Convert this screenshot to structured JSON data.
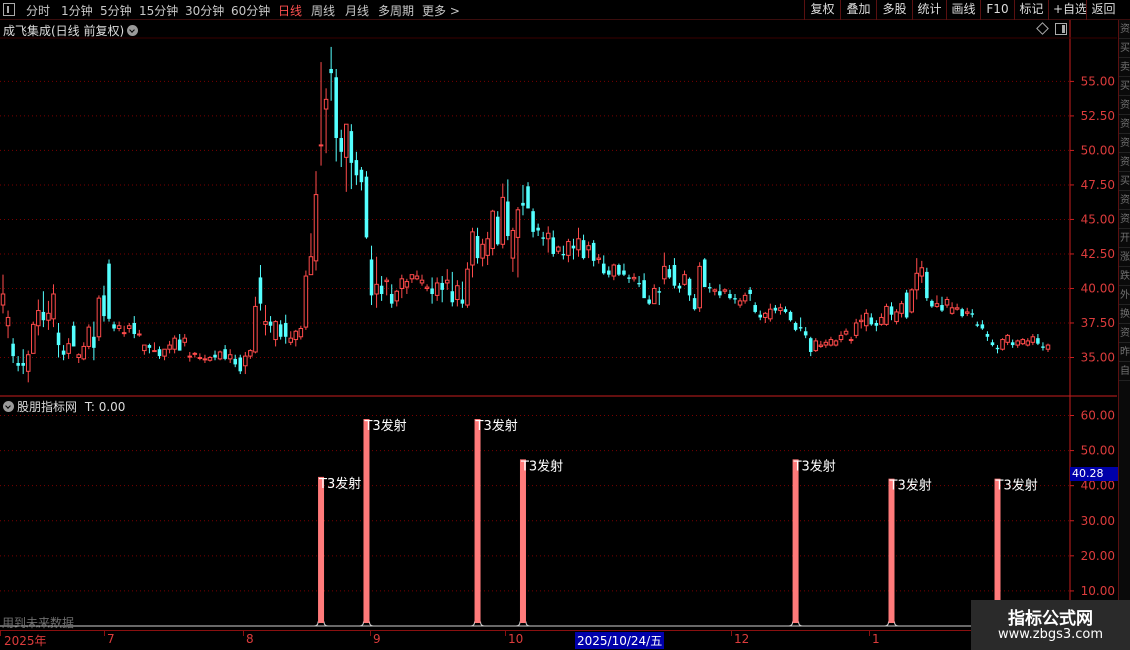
{
  "toolbar": {
    "periods": [
      "分时",
      "1分钟",
      "5分钟",
      "15分钟",
      "30分钟",
      "60分钟",
      "日线",
      "周线",
      "月线",
      "多周期",
      "更多 >"
    ],
    "active_period": "日线",
    "right_buttons": [
      "复权",
      "叠加",
      "多股",
      "统计",
      "画线",
      "F10",
      "标记",
      "+自选",
      "返回"
    ]
  },
  "main_chart": {
    "title": "成飞集成(日线 前复权)",
    "y_ticks": [
      "55.00",
      "52.50",
      "50.00",
      "47.50",
      "45.00",
      "42.50",
      "40.00",
      "37.50",
      "35.00"
    ]
  },
  "sub_chart": {
    "title": "股朋指标网",
    "t_label": "T: 0.00",
    "y_ticks": [
      "60.00",
      "50.00",
      "40.00",
      "30.00",
      "20.00",
      "10.00"
    ],
    "current_value": "40.28",
    "future_note": "用到未来数据",
    "signal_label": "T3发射"
  },
  "date_axis": {
    "labels": [
      "2025年",
      "7",
      "8",
      "9",
      "10",
      "12",
      "1"
    ],
    "cursor_date": "2025/10/24/五"
  },
  "right_strip": [
    "资",
    "买",
    "卖",
    "买",
    "资",
    "资",
    "资",
    "资",
    "买",
    "资",
    "资",
    "开",
    "涨",
    "跌",
    "外",
    "换",
    "资",
    "昨",
    "自"
  ],
  "watermark": {
    "title": "指标公式网",
    "url": "www.zbgs3.com"
  },
  "colors": {
    "up": "#ff4b4b",
    "down": "#54ffff",
    "signal": "#ff7a7a",
    "grid": "#7a0000",
    "axis": "#c81e1e"
  },
  "chart_data": [
    {
      "type": "candlestick",
      "title": "成飞集成(日线 前复权)",
      "ylim": [
        32.5,
        58
      ],
      "y_ticks": [
        55,
        52.5,
        50,
        47.5,
        45,
        42.5,
        40,
        37.5,
        35
      ],
      "ohlc": [
        [
          38.8,
          41,
          38.2,
          39.6
        ],
        [
          37.3,
          38.4,
          36.4,
          37.9
        ],
        [
          36,
          36.4,
          34.6,
          35.1
        ],
        [
          34.6,
          35.1,
          34,
          34.4
        ],
        [
          34.6,
          35.6,
          33.8,
          34.4
        ],
        [
          34,
          35.5,
          33.2,
          35.2
        ],
        [
          35.3,
          37.6,
          35.3,
          37.4
        ],
        [
          37.3,
          39.2,
          36.6,
          38.4
        ],
        [
          38.3,
          39.8,
          37.2,
          37.7
        ],
        [
          37.7,
          39.1,
          37,
          38.2
        ],
        [
          37.8,
          40.3,
          37.2,
          39.6
        ],
        [
          36.8,
          37.5,
          35,
          35.9
        ],
        [
          35.5,
          35.9,
          34.8,
          35.2
        ],
        [
          35.3,
          36.4,
          34.9,
          36
        ],
        [
          37.3,
          37.6,
          35.8,
          35.8
        ],
        [
          35,
          35.3,
          34.6,
          35.2
        ],
        [
          34.9,
          36.1,
          34.8,
          35.8
        ],
        [
          35.8,
          37.4,
          35.6,
          37.2
        ],
        [
          36.5,
          37.6,
          34.8,
          35.7
        ],
        [
          36.5,
          39.5,
          36.2,
          39.3
        ],
        [
          39.5,
          40.2,
          37.6,
          38
        ],
        [
          41.8,
          42.1,
          37.6,
          37.8
        ],
        [
          37.4,
          37.6,
          36.9,
          37.1
        ],
        [
          37.1,
          37.6,
          36.9,
          37.3
        ],
        [
          36.8,
          37.3,
          36.5,
          36.8
        ],
        [
          37.1,
          37.5,
          36.8,
          37.3
        ],
        [
          37.5,
          38,
          36.4,
          36.7
        ],
        [
          36.7,
          37,
          36.5,
          36.7
        ],
        [
          35.5,
          35.9,
          35.2,
          35.9
        ],
        [
          35.9,
          36,
          35.3,
          35.7
        ],
        [
          35.5,
          36.1,
          35.4,
          35.5
        ],
        [
          35.6,
          35.8,
          34.9,
          35.1
        ],
        [
          35.1,
          35.6,
          34.8,
          35.6
        ],
        [
          35.6,
          36.2,
          35.3,
          35.9
        ],
        [
          35.6,
          36.6,
          35.3,
          36.4
        ],
        [
          36.3,
          36.7,
          35.5,
          35.5
        ],
        [
          36.1,
          36.7,
          35.8,
          36.4
        ],
        [
          35.1,
          35.4,
          34.7,
          35.1
        ],
        [
          35.3,
          35.4,
          35,
          35.3
        ],
        [
          35,
          35.3,
          34.8,
          35
        ],
        [
          34.9,
          35.2,
          34.6,
          34.9
        ],
        [
          34.8,
          35.1,
          34.7,
          35
        ],
        [
          35.2,
          35.5,
          34.8,
          35
        ],
        [
          34.9,
          35.5,
          34.8,
          35.4
        ],
        [
          35.6,
          35.9,
          34.8,
          34.9
        ],
        [
          34.9,
          35.6,
          34.6,
          35.2
        ],
        [
          34.9,
          35.2,
          34.3,
          34.5
        ],
        [
          35,
          35.2,
          33.8,
          34
        ],
        [
          34.4,
          35.4,
          33.8,
          35.1
        ],
        [
          35.1,
          35.6,
          34.9,
          35.5
        ],
        [
          35.4,
          39.4,
          35.3,
          38.7
        ],
        [
          40.8,
          41.7,
          38.4,
          38.9
        ],
        [
          37.4,
          38.8,
          36.6,
          37.6
        ],
        [
          37.6,
          38,
          36.8,
          37.3
        ],
        [
          36.3,
          37.7,
          35.8,
          37.6
        ],
        [
          37.4,
          37.7,
          36.3,
          36.5
        ],
        [
          37.5,
          38.1,
          36,
          36.5
        ],
        [
          36.1,
          36.9,
          35.9,
          36.4
        ],
        [
          36.3,
          37,
          35.8,
          36.9
        ],
        [
          36.5,
          37.3,
          36.3,
          37.1
        ],
        [
          37.2,
          41.3,
          37,
          40.9
        ],
        [
          41,
          44,
          41,
          42.3
        ],
        [
          42,
          48.5,
          41.3,
          46.8
        ],
        [
          50.4,
          56.4,
          48.9,
          50.4
        ],
        [
          53,
          54.5,
          49.8,
          53.7
        ],
        [
          55.9,
          57.5,
          53.6,
          55.6
        ],
        [
          55.3,
          55.9,
          49.2,
          50.9
        ],
        [
          50.9,
          51.5,
          48.8,
          49.9
        ],
        [
          49.5,
          51.9,
          47,
          51.9
        ],
        [
          51.4,
          51.9,
          47.2,
          49.1
        ],
        [
          49.3,
          49.9,
          47.5,
          48.2
        ],
        [
          48.6,
          48.8,
          47.1,
          47.7
        ],
        [
          48.1,
          48.5,
          43.6,
          43.7
        ],
        [
          42.1,
          43.1,
          38.8,
          39.5
        ],
        [
          39.6,
          42.3,
          38.6,
          40.3
        ],
        [
          40.2,
          40.9,
          39.1,
          39.6
        ],
        [
          40.5,
          40.8,
          39.5,
          40.6
        ],
        [
          39.6,
          40.3,
          38.6,
          38.9
        ],
        [
          39.1,
          39.9,
          38.7,
          39.8
        ],
        [
          40,
          41,
          39.3,
          40.7
        ],
        [
          40.1,
          40.7,
          39.6,
          40.5
        ],
        [
          40.7,
          41,
          40.4,
          41
        ],
        [
          40.7,
          41.3,
          40.6,
          40.9
        ],
        [
          40.4,
          41,
          40.2,
          40.6
        ],
        [
          40,
          40.3,
          39.8,
          40.1
        ],
        [
          40,
          40.8,
          38.9,
          39.6
        ],
        [
          39.5,
          40.8,
          39.1,
          40.4
        ],
        [
          40.4,
          40.9,
          39,
          39.9
        ],
        [
          40.4,
          41.4,
          39.9,
          40.6
        ],
        [
          39.8,
          41.2,
          38.7,
          39
        ],
        [
          39.2,
          40.6,
          38.7,
          40.2
        ],
        [
          39.2,
          40.5,
          38.6,
          38.9
        ],
        [
          38.8,
          41.9,
          38.6,
          41.4
        ],
        [
          41.7,
          44.4,
          40.8,
          44.1
        ],
        [
          43.8,
          44.4,
          41.8,
          42.2
        ],
        [
          42.2,
          43.6,
          41.6,
          43.2
        ],
        [
          42.4,
          44.1,
          41.7,
          43.6
        ],
        [
          42.9,
          45.7,
          42.4,
          45.6
        ],
        [
          45.2,
          45.6,
          43.1,
          43.2
        ],
        [
          43.2,
          47.6,
          42.9,
          46.6
        ],
        [
          46.3,
          47.9,
          43.5,
          43.8
        ],
        [
          42.2,
          44.4,
          41.2,
          44.2
        ],
        [
          43.7,
          45.9,
          40.8,
          45.7
        ],
        [
          46.2,
          47.5,
          45.3,
          46
        ],
        [
          47.4,
          47.7,
          45.8,
          45.8
        ],
        [
          45.6,
          45.8,
          43.7,
          44.1
        ],
        [
          44.4,
          44.7,
          43.8,
          44.2
        ],
        [
          43.7,
          44.1,
          43.1,
          43.6
        ],
        [
          43.6,
          44.5,
          42.6,
          44
        ],
        [
          43.7,
          44.2,
          42.3,
          42.5
        ],
        [
          42.7,
          43.1,
          42.5,
          43
        ],
        [
          42.5,
          43.1,
          42.1,
          42.4
        ],
        [
          42.4,
          43.6,
          41.9,
          43.4
        ],
        [
          43.1,
          43.6,
          42.1,
          42.9
        ],
        [
          42.8,
          44.4,
          42.3,
          43.6
        ],
        [
          43.5,
          43.9,
          42.1,
          42.2
        ],
        [
          42.8,
          43.4,
          42.2,
          43.1
        ],
        [
          43.3,
          43.5,
          41.6,
          42
        ],
        [
          42.1,
          42.5,
          41.8,
          42.2
        ],
        [
          41.8,
          42.4,
          41,
          41.1
        ],
        [
          41.3,
          41.6,
          40.8,
          41
        ],
        [
          40.9,
          41.8,
          40.6,
          41.7
        ],
        [
          41.7,
          41.8,
          40.9,
          41
        ],
        [
          41.3,
          41.8,
          40.9,
          41
        ],
        [
          40.8,
          41,
          40.4,
          40.7
        ],
        [
          40.7,
          41.1,
          40.5,
          40.8
        ],
        [
          40.4,
          40.9,
          40.1,
          40.3
        ],
        [
          40.6,
          41.1,
          39.4,
          39.3
        ],
        [
          39.2,
          39.5,
          38.8,
          38.9
        ],
        [
          38.9,
          40.3,
          38.9,
          40
        ],
        [
          39.8,
          40.1,
          38.8,
          39.7
        ],
        [
          40.7,
          42.6,
          40.3,
          41.6
        ],
        [
          41.4,
          41.7,
          40.7,
          40.8
        ],
        [
          41.7,
          42.2,
          40,
          40.2
        ],
        [
          40.2,
          40.4,
          39.7,
          40
        ],
        [
          40.3,
          41.3,
          40.2,
          41
        ],
        [
          40.7,
          40.8,
          39.1,
          39.5
        ],
        [
          39.3,
          39.6,
          38.4,
          38.5
        ],
        [
          38.6,
          41.9,
          38.3,
          41.6
        ],
        [
          42.1,
          42.2,
          40.1,
          40.1
        ],
        [
          40.1,
          40.4,
          39.7,
          40
        ],
        [
          39.8,
          40,
          39.5,
          39.9
        ],
        [
          39.8,
          40.3,
          39.3,
          39.5
        ],
        [
          39.8,
          40,
          39.6,
          39.9
        ],
        [
          39.6,
          39.9,
          39.2,
          39.3
        ],
        [
          39.3,
          39.6,
          38.9,
          39.2
        ],
        [
          38.8,
          39.3,
          38.6,
          39.1
        ],
        [
          39.1,
          39.7,
          38.9,
          39.5
        ],
        [
          39.9,
          40.1,
          39.1,
          39.6
        ],
        [
          38.8,
          39,
          38.2,
          38.3
        ],
        [
          38.1,
          38.4,
          37.7,
          37.9
        ],
        [
          37.9,
          38.3,
          37.5,
          38.2
        ],
        [
          37.8,
          38.9,
          37.6,
          38.5
        ],
        [
          38.6,
          38.8,
          38.2,
          38.4
        ],
        [
          38.4,
          38.9,
          38.1,
          38.6
        ],
        [
          38.5,
          38.7,
          38.2,
          38.3
        ],
        [
          38.3,
          38.4,
          37.6,
          37.7
        ],
        [
          37.5,
          37.6,
          36.9,
          37
        ],
        [
          37.2,
          37.9,
          36.9,
          37.1
        ],
        [
          36.9,
          37.2,
          36.4,
          36.6
        ],
        [
          36.4,
          36.5,
          35.1,
          35.4
        ],
        [
          35.5,
          36.4,
          35.4,
          36.2
        ],
        [
          35.8,
          36.2,
          35.7,
          35.9
        ],
        [
          35.9,
          36.3,
          35.7,
          36.1
        ],
        [
          35.9,
          36.5,
          35.8,
          36.3
        ],
        [
          35.9,
          36.3,
          35.8,
          36.2
        ],
        [
          36.3,
          36.9,
          36.1,
          36.6
        ],
        [
          36.7,
          37.1,
          36.6,
          36.9
        ],
        [
          36.3,
          36.5,
          36,
          36.3
        ],
        [
          36.6,
          37.8,
          36.4,
          37.5
        ],
        [
          37.6,
          38.1,
          37.1,
          37.7
        ],
        [
          37.3,
          38.5,
          36.9,
          38.2
        ],
        [
          37.9,
          38.2,
          37.3,
          37.4
        ],
        [
          37.5,
          37.7,
          36.9,
          37.3
        ],
        [
          37.4,
          38.2,
          37.3,
          37.9
        ],
        [
          37.4,
          38.9,
          37.3,
          38.7
        ],
        [
          38.7,
          39,
          37.7,
          38.1
        ],
        [
          37.6,
          38.5,
          37.4,
          38.3
        ],
        [
          38.2,
          39.1,
          37.9,
          38.9
        ],
        [
          39.7,
          39.9,
          37.8,
          37.9
        ],
        [
          38.3,
          40,
          38.2,
          39.9
        ],
        [
          39.9,
          42.2,
          39.2,
          41.1
        ],
        [
          40.9,
          42,
          40.4,
          41.5
        ],
        [
          41.2,
          41.5,
          39.1,
          39.3
        ],
        [
          39.1,
          39.2,
          38.6,
          38.7
        ],
        [
          38.7,
          39.5,
          38.6,
          38.9
        ],
        [
          38.8,
          39.4,
          38.3,
          38.4
        ],
        [
          38.8,
          39.4,
          38.6,
          39.2
        ],
        [
          38.2,
          39,
          38.1,
          38.6
        ],
        [
          38.5,
          38.9,
          38.4,
          38.6
        ],
        [
          38.5,
          38.6,
          37.9,
          38
        ],
        [
          38.2,
          38.6,
          38,
          38.3
        ],
        [
          38.2,
          38.5,
          37.9,
          38.1
        ],
        [
          37.4,
          37.6,
          37.2,
          37.3
        ],
        [
          37.4,
          37.7,
          37,
          37.1
        ],
        [
          36.7,
          36.9,
          36.2,
          36.5
        ],
        [
          36.1,
          36.3,
          35.8,
          35.9
        ],
        [
          35.7,
          35.9,
          35.3,
          35.6
        ],
        [
          35.6,
          36.4,
          35.5,
          36.3
        ],
        [
          36.1,
          36.7,
          35.9,
          36.6
        ],
        [
          36.1,
          36.3,
          35.7,
          35.9
        ],
        [
          35.9,
          36.3,
          35.7,
          36.2
        ],
        [
          36,
          36.4,
          35.9,
          36.3
        ],
        [
          35.9,
          36.4,
          35.8,
          36.2
        ],
        [
          36.1,
          36.7,
          35.9,
          36.5
        ],
        [
          36.4,
          36.7,
          35.9,
          36
        ],
        [
          35.8,
          36.1,
          35.5,
          35.7
        ],
        [
          35.6,
          36,
          35.4,
          35.9
        ]
      ]
    },
    {
      "type": "bar",
      "title": "股朋指标网",
      "ylim": [
        0,
        61
      ],
      "y_ticks": [
        60,
        50,
        40,
        30,
        20,
        10
      ],
      "series": [
        {
          "name": "T3发射",
          "values": [
            42.5,
            59.0,
            59.0,
            47.5,
            47.5,
            42.0,
            42.0
          ]
        }
      ]
    }
  ]
}
